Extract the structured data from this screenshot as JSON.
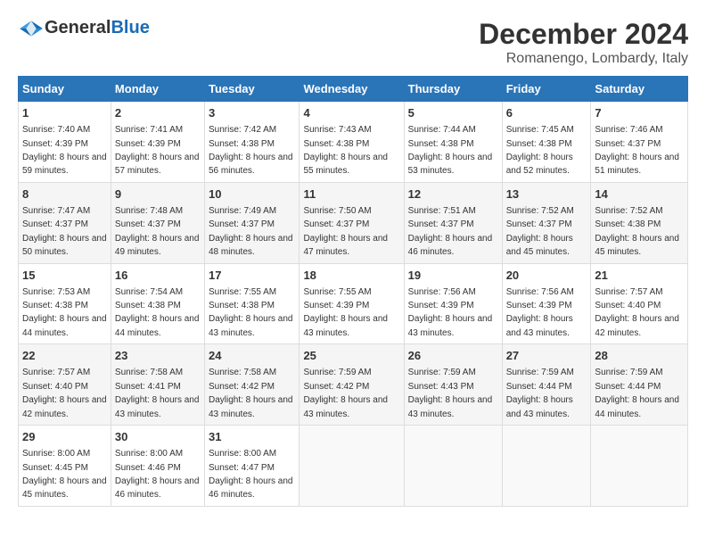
{
  "logo": {
    "general": "General",
    "blue": "Blue"
  },
  "title": "December 2024",
  "location": "Romanengo, Lombardy, Italy",
  "headers": [
    "Sunday",
    "Monday",
    "Tuesday",
    "Wednesday",
    "Thursday",
    "Friday",
    "Saturday"
  ],
  "weeks": [
    [
      {
        "day": "1",
        "sunrise": "7:40 AM",
        "sunset": "4:39 PM",
        "daylight": "8 hours and 59 minutes."
      },
      {
        "day": "2",
        "sunrise": "7:41 AM",
        "sunset": "4:39 PM",
        "daylight": "8 hours and 57 minutes."
      },
      {
        "day": "3",
        "sunrise": "7:42 AM",
        "sunset": "4:38 PM",
        "daylight": "8 hours and 56 minutes."
      },
      {
        "day": "4",
        "sunrise": "7:43 AM",
        "sunset": "4:38 PM",
        "daylight": "8 hours and 55 minutes."
      },
      {
        "day": "5",
        "sunrise": "7:44 AM",
        "sunset": "4:38 PM",
        "daylight": "8 hours and 53 minutes."
      },
      {
        "day": "6",
        "sunrise": "7:45 AM",
        "sunset": "4:38 PM",
        "daylight": "8 hours and 52 minutes."
      },
      {
        "day": "7",
        "sunrise": "7:46 AM",
        "sunset": "4:37 PM",
        "daylight": "8 hours and 51 minutes."
      }
    ],
    [
      {
        "day": "8",
        "sunrise": "7:47 AM",
        "sunset": "4:37 PM",
        "daylight": "8 hours and 50 minutes."
      },
      {
        "day": "9",
        "sunrise": "7:48 AM",
        "sunset": "4:37 PM",
        "daylight": "8 hours and 49 minutes."
      },
      {
        "day": "10",
        "sunrise": "7:49 AM",
        "sunset": "4:37 PM",
        "daylight": "8 hours and 48 minutes."
      },
      {
        "day": "11",
        "sunrise": "7:50 AM",
        "sunset": "4:37 PM",
        "daylight": "8 hours and 47 minutes."
      },
      {
        "day": "12",
        "sunrise": "7:51 AM",
        "sunset": "4:37 PM",
        "daylight": "8 hours and 46 minutes."
      },
      {
        "day": "13",
        "sunrise": "7:52 AM",
        "sunset": "4:37 PM",
        "daylight": "8 hours and 45 minutes."
      },
      {
        "day": "14",
        "sunrise": "7:52 AM",
        "sunset": "4:38 PM",
        "daylight": "8 hours and 45 minutes."
      }
    ],
    [
      {
        "day": "15",
        "sunrise": "7:53 AM",
        "sunset": "4:38 PM",
        "daylight": "8 hours and 44 minutes."
      },
      {
        "day": "16",
        "sunrise": "7:54 AM",
        "sunset": "4:38 PM",
        "daylight": "8 hours and 44 minutes."
      },
      {
        "day": "17",
        "sunrise": "7:55 AM",
        "sunset": "4:38 PM",
        "daylight": "8 hours and 43 minutes."
      },
      {
        "day": "18",
        "sunrise": "7:55 AM",
        "sunset": "4:39 PM",
        "daylight": "8 hours and 43 minutes."
      },
      {
        "day": "19",
        "sunrise": "7:56 AM",
        "sunset": "4:39 PM",
        "daylight": "8 hours and 43 minutes."
      },
      {
        "day": "20",
        "sunrise": "7:56 AM",
        "sunset": "4:39 PM",
        "daylight": "8 hours and 43 minutes."
      },
      {
        "day": "21",
        "sunrise": "7:57 AM",
        "sunset": "4:40 PM",
        "daylight": "8 hours and 42 minutes."
      }
    ],
    [
      {
        "day": "22",
        "sunrise": "7:57 AM",
        "sunset": "4:40 PM",
        "daylight": "8 hours and 42 minutes."
      },
      {
        "day": "23",
        "sunrise": "7:58 AM",
        "sunset": "4:41 PM",
        "daylight": "8 hours and 43 minutes."
      },
      {
        "day": "24",
        "sunrise": "7:58 AM",
        "sunset": "4:42 PM",
        "daylight": "8 hours and 43 minutes."
      },
      {
        "day": "25",
        "sunrise": "7:59 AM",
        "sunset": "4:42 PM",
        "daylight": "8 hours and 43 minutes."
      },
      {
        "day": "26",
        "sunrise": "7:59 AM",
        "sunset": "4:43 PM",
        "daylight": "8 hours and 43 minutes."
      },
      {
        "day": "27",
        "sunrise": "7:59 AM",
        "sunset": "4:44 PM",
        "daylight": "8 hours and 43 minutes."
      },
      {
        "day": "28",
        "sunrise": "7:59 AM",
        "sunset": "4:44 PM",
        "daylight": "8 hours and 44 minutes."
      }
    ],
    [
      {
        "day": "29",
        "sunrise": "8:00 AM",
        "sunset": "4:45 PM",
        "daylight": "8 hours and 45 minutes."
      },
      {
        "day": "30",
        "sunrise": "8:00 AM",
        "sunset": "4:46 PM",
        "daylight": "8 hours and 46 minutes."
      },
      {
        "day": "31",
        "sunrise": "8:00 AM",
        "sunset": "4:47 PM",
        "daylight": "8 hours and 46 minutes."
      },
      null,
      null,
      null,
      null
    ]
  ]
}
